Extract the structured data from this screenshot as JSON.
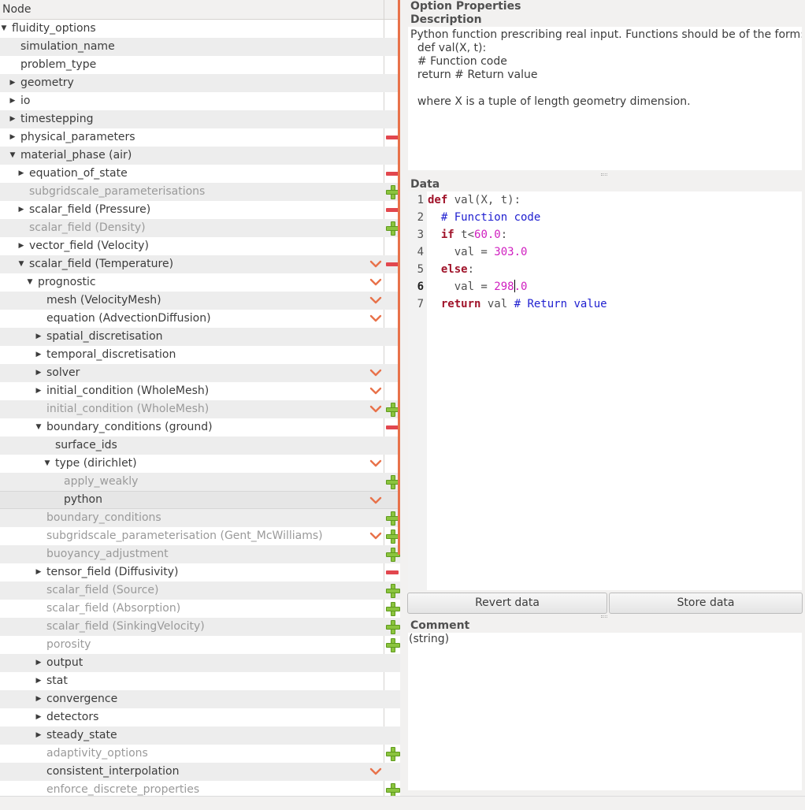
{
  "tree": {
    "header": "Node",
    "rows": [
      {
        "label": "fluidity_options",
        "expander": "open"
      },
      {
        "label": "simulation_name"
      },
      {
        "label": "problem_type"
      },
      {
        "label": "geometry",
        "expander": "closed"
      },
      {
        "label": "io",
        "expander": "closed"
      },
      {
        "label": "timestepping",
        "expander": "closed"
      },
      {
        "label": "physical_parameters",
        "expander": "closed"
      },
      {
        "label": "material_phase (air)",
        "expander": "open"
      },
      {
        "label": "equation_of_state",
        "expander": "closed"
      },
      {
        "label": "subgridscale_parameterisations",
        "inactive": true
      },
      {
        "label": "scalar_field (Pressure)",
        "expander": "closed"
      },
      {
        "label": "scalar_field (Density)",
        "inactive": true
      },
      {
        "label": "vector_field (Velocity)",
        "expander": "closed"
      },
      {
        "label": "scalar_field (Temperature)",
        "expander": "open"
      },
      {
        "label": "prognostic",
        "expander": "open"
      },
      {
        "label": "mesh (VelocityMesh)"
      },
      {
        "label": "equation (AdvectionDiffusion)"
      },
      {
        "label": "spatial_discretisation",
        "expander": "closed"
      },
      {
        "label": "temporal_discretisation",
        "expander": "closed"
      },
      {
        "label": "solver",
        "expander": "closed"
      },
      {
        "label": "initial_condition (WholeMesh)",
        "expander": "closed"
      },
      {
        "label": "initial_condition (WholeMesh)",
        "inactive": true
      },
      {
        "label": "boundary_conditions (ground)",
        "expander": "open"
      },
      {
        "label": "surface_ids"
      },
      {
        "label": "type (dirichlet)",
        "expander": "open"
      },
      {
        "label": "apply_weakly",
        "inactive": true
      },
      {
        "label": "python",
        "selected": true
      },
      {
        "label": "boundary_conditions",
        "inactive": true
      },
      {
        "label": "subgridscale_parameterisation (Gent_McWilliams)",
        "inactive": true
      },
      {
        "label": "buoyancy_adjustment",
        "inactive": true
      },
      {
        "label": "tensor_field (Diffusivity)",
        "expander": "closed"
      },
      {
        "label": "scalar_field (Source)",
        "inactive": true
      },
      {
        "label": "scalar_field (Absorption)",
        "inactive": true
      },
      {
        "label": "scalar_field (SinkingVelocity)",
        "inactive": true
      },
      {
        "label": "porosity",
        "inactive": true
      },
      {
        "label": "output",
        "expander": "closed"
      },
      {
        "label": "stat",
        "expander": "closed"
      },
      {
        "label": "convergence",
        "expander": "closed"
      },
      {
        "label": "detectors",
        "expander": "closed"
      },
      {
        "label": "steady_state",
        "expander": "closed"
      },
      {
        "label": "adaptivity_options",
        "inactive": true
      },
      {
        "label": "consistent_interpolation"
      },
      {
        "label": "enforce_discrete_properties",
        "inactive": true
      }
    ]
  },
  "properties": {
    "title": "Option Properties",
    "description_heading": "Description",
    "description_text": "Python function prescribing real input. Functions should be of the form:\n  def val(X, t):\n  # Function code\n  return # Return value\n\n  where X is a tuple of length geometry dimension.",
    "data_heading": "Data",
    "code_lines": [
      {
        "n": "1",
        "text": "def val(X, t):"
      },
      {
        "n": "2",
        "text": "  # Function code"
      },
      {
        "n": "3",
        "text": "  if t<60.0:"
      },
      {
        "n": "4",
        "text": "    val = 303.0"
      },
      {
        "n": "5",
        "text": "  else:"
      },
      {
        "n": "6",
        "text": "    val = 298.0"
      },
      {
        "n": "7",
        "text": "  return val # Return value"
      }
    ],
    "current_line": "6",
    "revert_label": "Revert data",
    "store_label": "Store data",
    "comment_heading": "Comment",
    "comment_text": "(string)"
  },
  "colors": {
    "splitter": "#e8724a",
    "remove": "#e2474e",
    "add": "#8bc43e",
    "chevron": "#e8724a",
    "keyword": "#a0132a",
    "number": "#d020c0",
    "comment": "#2020d0"
  },
  "icons": {
    "expand_open": "triangle-down-icon",
    "expand_closed": "triangle-right-icon",
    "choice": "chevron-down-icon",
    "remove": "minus-icon",
    "add": "plus-icon"
  }
}
